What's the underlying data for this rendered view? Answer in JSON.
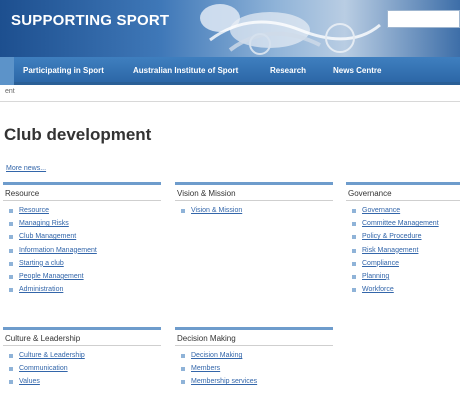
{
  "banner": {
    "title": "SUPPORTING SPORT"
  },
  "nav": {
    "items": [
      {
        "label": "Participating in Sport"
      },
      {
        "label": "Australian Institute of Sport"
      },
      {
        "label": "Research"
      },
      {
        "label": "News Centre"
      }
    ]
  },
  "breadcrumb": "ent",
  "page": {
    "title": "Club development",
    "more_news": "More news..."
  },
  "sections": [
    {
      "heading": "Resource",
      "links": [
        "Resource",
        "Managing Risks",
        "Club Management",
        "Information Management",
        "Starting a club",
        "People Management",
        "Administration"
      ]
    },
    {
      "heading": "Vision & Mission",
      "links": [
        "Vision & Mission"
      ]
    },
    {
      "heading": "Governance",
      "links": [
        "Governance",
        "Committee Management",
        "Policy & Procedure",
        "Risk Management",
        "Compliance",
        "Planning",
        "Workforce"
      ]
    },
    {
      "heading": "Culture & Leadership",
      "links": [
        "Culture & Leadership",
        "Communication",
        "Values"
      ]
    },
    {
      "heading": "Decision Making",
      "links": [
        "Decision Making",
        "Members",
        "Membership services"
      ]
    }
  ],
  "colors": {
    "banner_blue": "#1d4f8f",
    "nav_blue": "#2c67a7",
    "link_blue": "#3366aa",
    "section_bar": "#6e9ccc"
  }
}
